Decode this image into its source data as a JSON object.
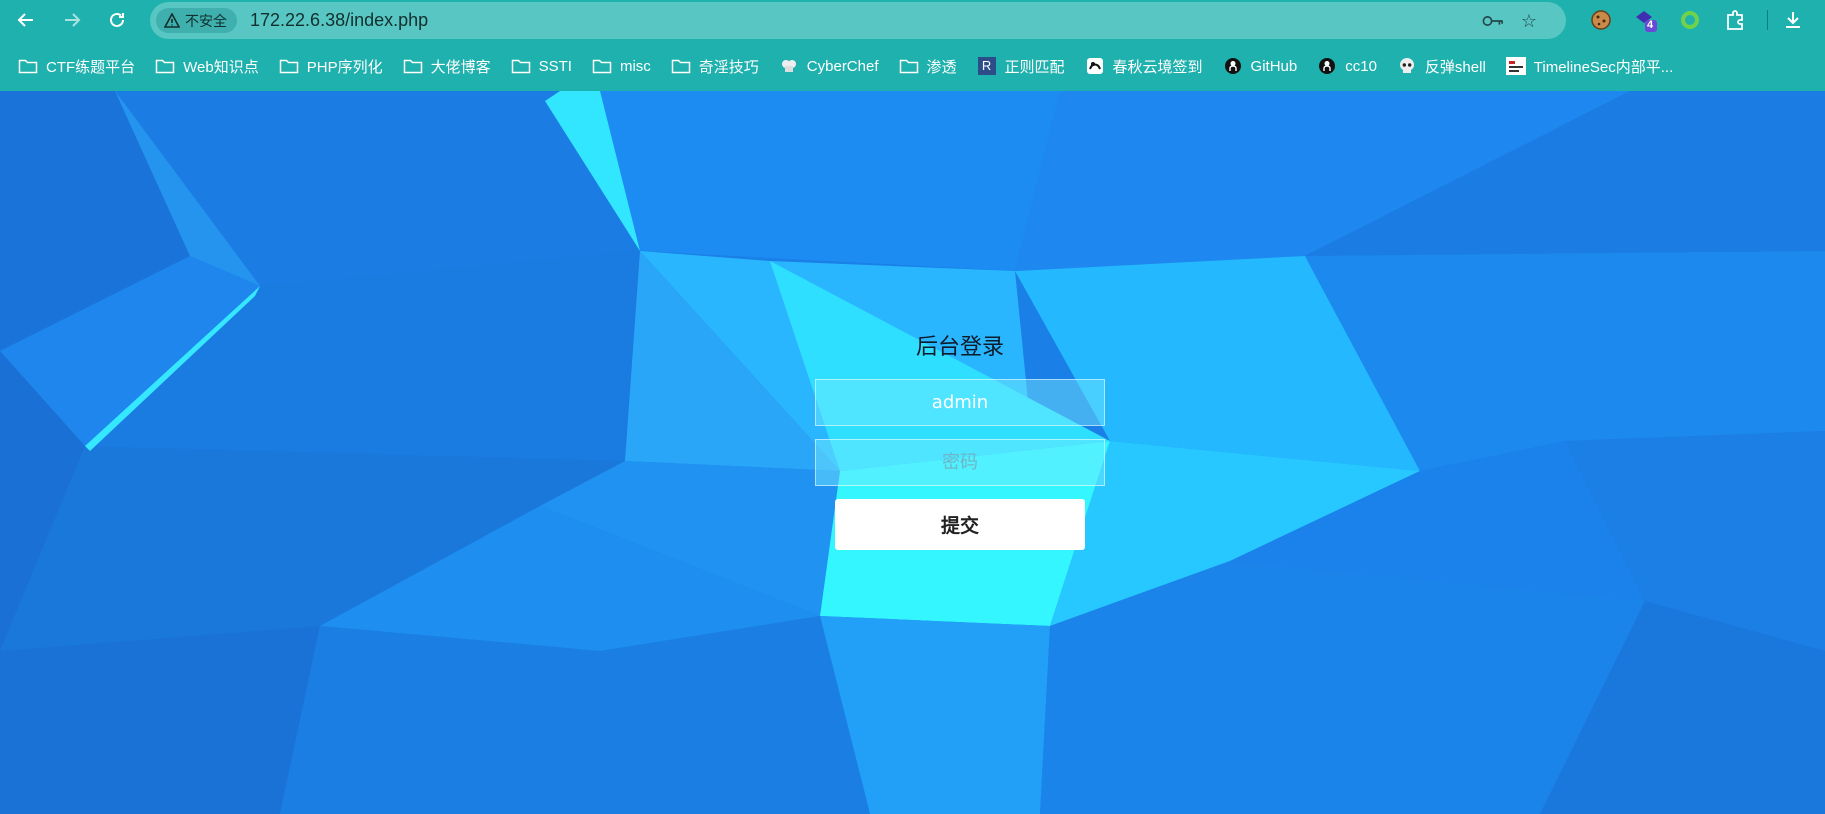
{
  "browser": {
    "security_label": "不安全",
    "url": "172.22.6.38/index.php",
    "extension_badge": "4"
  },
  "bookmarks": [
    {
      "label": "CTF练题平台",
      "icon": "folder-icon"
    },
    {
      "label": "Web知识点",
      "icon": "folder-icon"
    },
    {
      "label": "PHP序列化",
      "icon": "folder-icon"
    },
    {
      "label": "大佬博客",
      "icon": "folder-icon"
    },
    {
      "label": "SSTI",
      "icon": "folder-icon"
    },
    {
      "label": "misc",
      "icon": "folder-icon"
    },
    {
      "label": "奇淫技巧",
      "icon": "folder-icon"
    },
    {
      "label": "CyberChef",
      "icon": "chef-icon"
    },
    {
      "label": "渗透",
      "icon": "folder-icon"
    },
    {
      "label": "正则匹配",
      "icon": "r-icon",
      "icon_text": "R"
    },
    {
      "label": "春秋云境签到",
      "icon": "cloud-icon"
    },
    {
      "label": "GitHub",
      "icon": "github-icon"
    },
    {
      "label": "cc10",
      "icon": "github-icon"
    },
    {
      "label": "反弹shell",
      "icon": "skull-icon"
    },
    {
      "label": "TimelineSec内部平...",
      "icon": "timeline-icon"
    }
  ],
  "login": {
    "title": "后台登录",
    "username_value": "admin",
    "password_placeholder": "密码",
    "submit_label": "提交"
  },
  "colors": {
    "chrome": "#1fb1ae",
    "omnibox": "#58c6c2",
    "background": "#1a7fe6",
    "accent_cyan": "#33f0ff"
  }
}
